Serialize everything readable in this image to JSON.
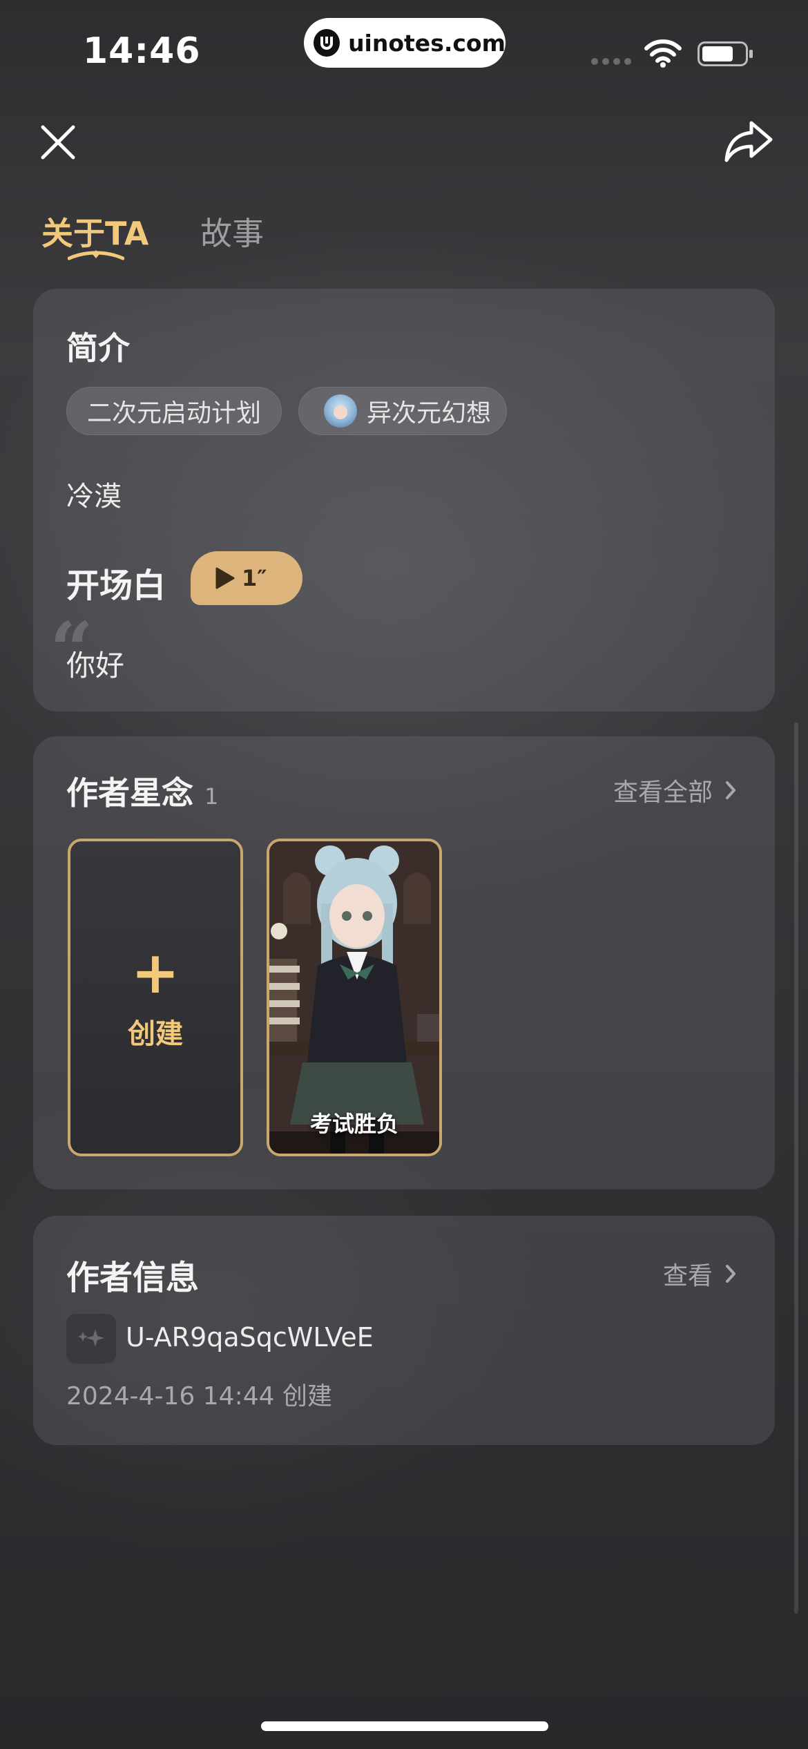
{
  "status_bar": {
    "time": "14:46",
    "url": "uinotes.com"
  },
  "tabs": [
    {
      "label": "关于TA",
      "active": true
    },
    {
      "label": "故事",
      "active": false
    }
  ],
  "intro": {
    "title": "简介",
    "tags": [
      {
        "label": "二次元启动计划"
      },
      {
        "label": "异次元幻想",
        "icon": "avatar"
      }
    ],
    "description": "冷漠",
    "opening_title": "开场白",
    "voice_duration": "1″",
    "greeting": "你好"
  },
  "works": {
    "title": "作者星念",
    "count": "1",
    "view_all": "查看全部",
    "create_label": "创建",
    "items": [
      {
        "title": "考试胜负"
      }
    ]
  },
  "author": {
    "title": "作者信息",
    "view": "查看",
    "user_id": "U-AR9qaSqcWLVeE",
    "created": "2024-4-16 14:44 创建"
  },
  "colors": {
    "accent": "#f2c87a",
    "voice_pill": "#ddb57c",
    "card_border": "#c9a870"
  }
}
